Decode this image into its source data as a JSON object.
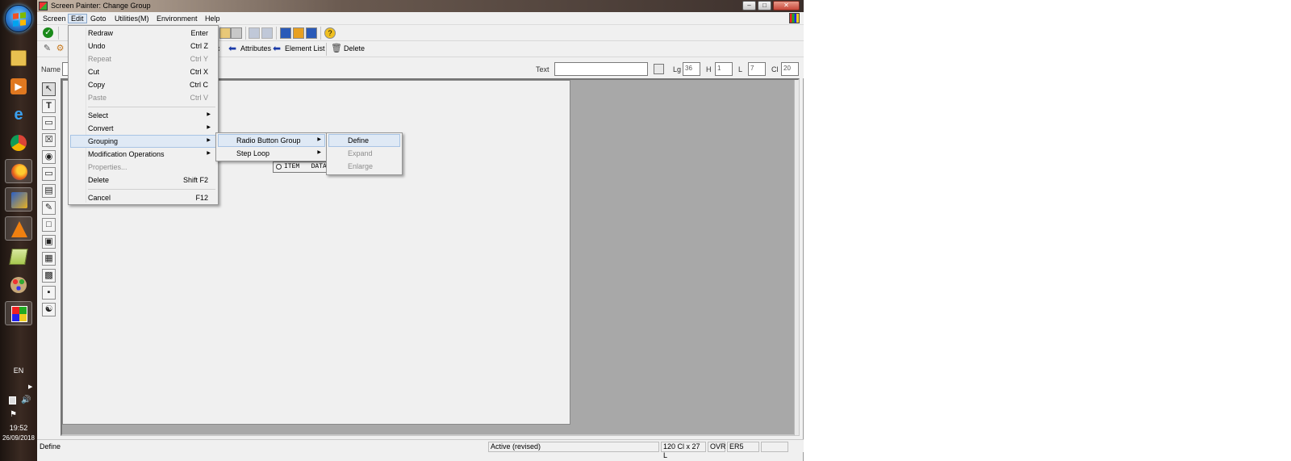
{
  "taskbar": {
    "apps": [
      {
        "icon": "file-explorer-icon"
      },
      {
        "icon": "media-player-icon"
      },
      {
        "icon": "internet-explorer-icon"
      },
      {
        "icon": "chrome-icon"
      },
      {
        "icon": "firefox-icon"
      },
      {
        "icon": "sap-logon-icon"
      },
      {
        "icon": "vlc-icon"
      },
      {
        "icon": "sap-gui-icon"
      },
      {
        "icon": "paint-icon"
      },
      {
        "icon": "screen-painter-icon"
      }
    ],
    "language": "EN",
    "time": "19:52",
    "date": "26/09/2018"
  },
  "window": {
    "title": "Screen Painter:  Change Group",
    "buttons": {
      "minimize": "–",
      "maximize": "□",
      "close": "✕"
    }
  },
  "menubar": {
    "items": [
      "Screen",
      "Edit",
      "Goto",
      "Utilities(M)",
      "Environment",
      "Help"
    ],
    "open": "Edit"
  },
  "toolbar2": {
    "attributes_label": "Attributes",
    "element_list_label": "Element List",
    "delete_label": "Delete",
    "partial_label": "c"
  },
  "fields": {
    "name_label": "Name",
    "text_label": "Text",
    "name_value": "",
    "text_value": "",
    "lg_label": "Lg",
    "lg_value": "36",
    "h_label": "H",
    "h_value": "1",
    "l_label": "L",
    "l_value": "7",
    "cl_label": "Cl",
    "cl_value": "20"
  },
  "canvas": {
    "radio_text": "ITEM   DATA"
  },
  "edit_menu": {
    "items": [
      {
        "label": "Redraw",
        "shortcut": "Enter",
        "enabled": true
      },
      {
        "label": "Undo",
        "shortcut": "Ctrl Z",
        "enabled": true
      },
      {
        "label": "Repeat",
        "shortcut": "Ctrl Y",
        "enabled": false
      },
      {
        "label": "Cut",
        "shortcut": "Ctrl X",
        "enabled": true
      },
      {
        "label": "Copy",
        "shortcut": "Ctrl C",
        "enabled": true
      },
      {
        "label": "Paste",
        "shortcut": "Ctrl V",
        "enabled": false
      },
      {
        "label": "Select",
        "submenu": true,
        "enabled": true
      },
      {
        "label": "Convert",
        "submenu": true,
        "enabled": true
      },
      {
        "label": "Grouping",
        "submenu": true,
        "enabled": true,
        "highlighted": true
      },
      {
        "label": "Modification Operations",
        "submenu": true,
        "enabled": true
      },
      {
        "label": "Properties...",
        "enabled": false
      },
      {
        "label": "Delete",
        "shortcut": "Shift F2",
        "enabled": true
      },
      {
        "label": "Cancel",
        "shortcut": "F12",
        "enabled": true
      }
    ]
  },
  "grouping_menu": {
    "items": [
      {
        "label": "Radio Button Group",
        "submenu": true,
        "highlighted": true
      },
      {
        "label": "Step Loop",
        "submenu": true
      }
    ]
  },
  "radio_menu": {
    "items": [
      {
        "label": "Define",
        "enabled": true,
        "highlighted": true
      },
      {
        "label": "Expand",
        "enabled": false
      },
      {
        "label": "Enlarge",
        "enabled": false
      }
    ]
  },
  "statusbar": {
    "message": "Define",
    "mode": "Active (revised)",
    "size": "120 Cl x 27 L",
    "insert_mode": "OVR",
    "system": "ER5"
  },
  "colors": {
    "menu_highlight": "#dfe9f5",
    "canvas_background": "#f0f0f0",
    "workspace_gray": "#a8a8a8",
    "disabled_text": "#8d8d8d"
  }
}
